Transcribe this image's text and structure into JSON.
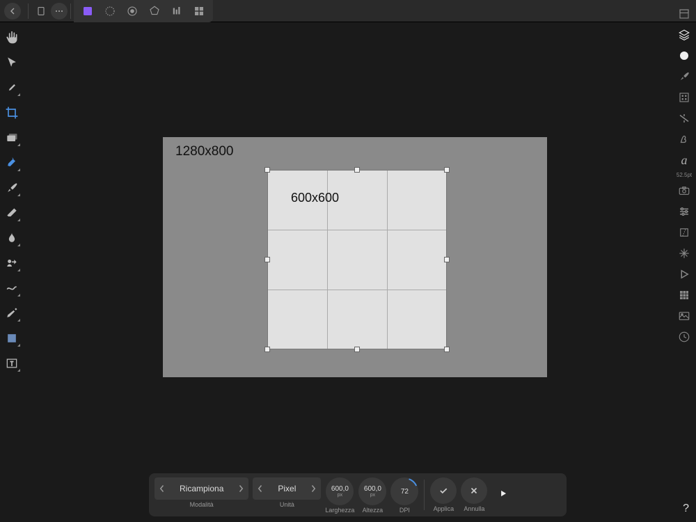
{
  "document": {
    "full_size_label": "1280x800",
    "crop_size_label": "600x600"
  },
  "context_bar": {
    "mode": {
      "value": "Ricampiona",
      "label": "Modalità"
    },
    "units": {
      "value": "Pixel",
      "label": "Unità"
    },
    "width": {
      "value": "600,0",
      "unit": "px",
      "label": "Larghezza"
    },
    "height": {
      "value": "600,0",
      "unit": "px",
      "label": "Altezza"
    },
    "dpi": {
      "value": "72",
      "label": "DPI"
    },
    "apply": {
      "label": "Applica"
    },
    "cancel": {
      "label": "Annulla"
    }
  },
  "right_panel": {
    "font_size": "52.5pt"
  },
  "help": "?"
}
